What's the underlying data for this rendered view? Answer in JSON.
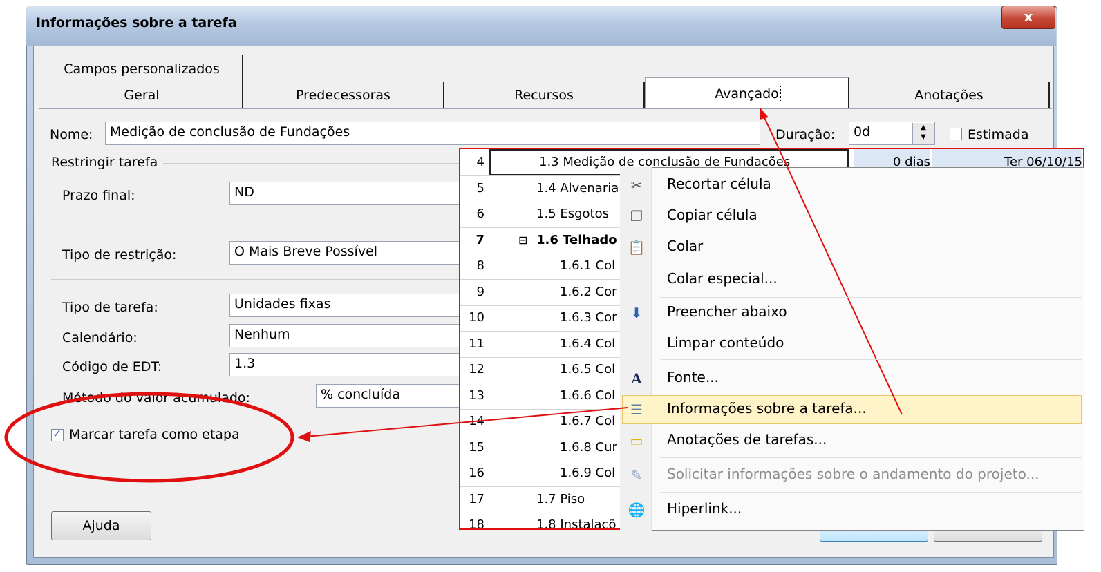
{
  "dialog": {
    "title": "Informações sobre a tarefa",
    "close_glyph": "x",
    "tabs_top": [
      "Campos personalizados"
    ],
    "tabs": [
      "Geral",
      "Predecessoras",
      "Recursos",
      "Avançado",
      "Anotações"
    ],
    "active_tab": "Avançado"
  },
  "form": {
    "name_label": "Nome:",
    "name_value": "Medição de conclusão de Fundações",
    "duration_label": "Duração:",
    "duration_value": "0d",
    "estimated_label": "Estimada",
    "estimated_checked": false,
    "constrain_group": "Restringir tarefa",
    "deadline_label": "Prazo final:",
    "deadline_value": "ND",
    "constraint_type_label": "Tipo de restrição:",
    "constraint_type_value": "O Mais Breve Possível",
    "task_type_label": "Tipo de tarefa:",
    "task_type_value": "Unidades fixas",
    "calendar_label": "Calendário:",
    "calendar_value": "Nenhum",
    "wbs_label": "Código de EDT:",
    "wbs_value": "1.3",
    "earned_value_label": "Método do valor acumulado:",
    "earned_value_value": "% concluída",
    "milestone_label": "Marcar tarefa como etapa",
    "milestone_checked": true,
    "help_button": "Ajuda"
  },
  "sheet": {
    "rows": [
      {
        "num": "4",
        "name": "1.3 Medição de conclusão de Fundações",
        "duration": "0 dias",
        "start": "Ter 06/10/15"
      },
      {
        "num": "5",
        "name": "1.4 Alvenaria"
      },
      {
        "num": "6",
        "name": "1.5 Esgotos"
      },
      {
        "num": "7",
        "name": "1.6 Telhado",
        "summary": true
      },
      {
        "num": "8",
        "name": "1.6.1 Col"
      },
      {
        "num": "9",
        "name": "1.6.2 Cor"
      },
      {
        "num": "10",
        "name": "1.6.3 Cor"
      },
      {
        "num": "11",
        "name": "1.6.4 Col"
      },
      {
        "num": "12",
        "name": "1.6.5 Col"
      },
      {
        "num": "13",
        "name": "1.6.6 Col"
      },
      {
        "num": "14",
        "name": "1.6.7 Col"
      },
      {
        "num": "15",
        "name": "1.6.8 Cur"
      },
      {
        "num": "16",
        "name": "1.6.9 Col"
      },
      {
        "num": "17",
        "name": "1.7 Piso"
      },
      {
        "num": "18",
        "name": "1.8 Instalaçõ"
      }
    ]
  },
  "context_menu": {
    "items": [
      {
        "label": "Recortar célula",
        "icon": "scissors-icon"
      },
      {
        "label": "Copiar célula",
        "icon": "copy-icon"
      },
      {
        "label": "Colar",
        "icon": "paste-icon"
      },
      {
        "label": "Colar especial...",
        "icon": ""
      },
      {
        "label": "Preencher abaixo",
        "icon": "fill-down-icon"
      },
      {
        "label": "Limpar conteúdo",
        "icon": ""
      },
      {
        "label": "Fonte...",
        "icon": "font-icon"
      },
      {
        "label": "Informações sobre a tarefa...",
        "icon": "task-info-icon",
        "highlighted": true
      },
      {
        "label": "Anotações de tarefas...",
        "icon": "notes-icon"
      },
      {
        "label": "Solicitar informações sobre o andamento do projeto...",
        "icon": "request-progress-icon",
        "disabled": true
      },
      {
        "label": "Hiperlink...",
        "icon": "hyperlink-icon"
      }
    ]
  },
  "colors": {
    "annotation_red": "#e01010",
    "menu_highlight": "#fff3c8",
    "window_title_blue": "#b6c9e2"
  }
}
